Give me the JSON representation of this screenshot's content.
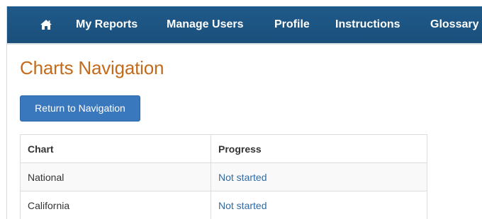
{
  "nav": {
    "home_icon": "home-icon",
    "items": [
      {
        "label": "My Reports"
      },
      {
        "label": "Manage Users"
      },
      {
        "label": "Profile"
      },
      {
        "label": "Instructions"
      },
      {
        "label": "Glossary"
      }
    ]
  },
  "page": {
    "title": "Charts Navigation",
    "return_button": "Return to Navigation"
  },
  "table": {
    "headers": {
      "chart": "Chart",
      "progress": "Progress"
    },
    "rows": [
      {
        "chart": "National",
        "progress": "Not started"
      },
      {
        "chart": "California",
        "progress": "Not started"
      }
    ]
  },
  "colors": {
    "navbar": "#1a4f7b",
    "title": "#c46a1b",
    "button": "#3a78bd",
    "link": "#2f6aa3"
  }
}
